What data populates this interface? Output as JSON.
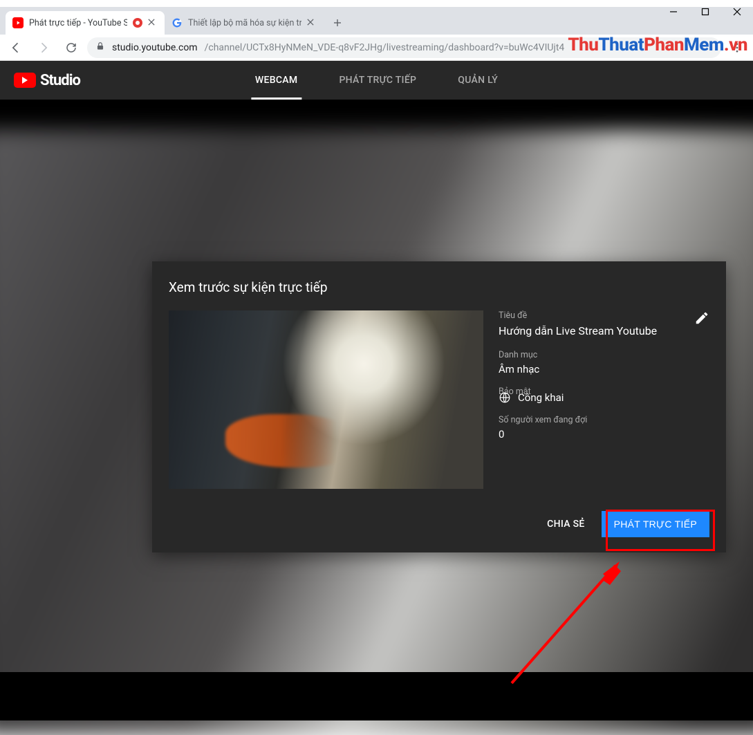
{
  "window": {
    "tabs": [
      {
        "title": "Phát trực tiếp - YouTube Stu",
        "active": true,
        "favicon": "youtube"
      },
      {
        "title": "Thiết lập bộ mã hóa sự kiện trực",
        "active": false,
        "favicon": "google"
      }
    ],
    "url_host": "studio.youtube.com",
    "url_path": "/channel/UCTx8HyNMeN_VDE-q8vF2JHg/livestreaming/dashboard?v=buWc4VIUjt4"
  },
  "watermark": {
    "parts": [
      "Thu",
      "Thuat",
      "Phan",
      "Mem",
      ".vn"
    ]
  },
  "studio": {
    "brand": "Studio",
    "nav": {
      "webcam": "WEBCAM",
      "live": "PHÁT TRỰC TIẾP",
      "manage": "QUẢN LÝ",
      "active": "webcam"
    }
  },
  "modal": {
    "title": "Xem trước sự kiện trực tiếp",
    "fields": {
      "title_label": "Tiêu đề",
      "title_value": "Hướng dẫn Live Stream Youtube",
      "category_label": "Danh mục",
      "category_value": "Âm nhạc",
      "privacy_label": "Bảo mật",
      "privacy_value": "Công khai",
      "waiting_label": "Số người xem đang đợi",
      "waiting_value": "0"
    },
    "actions": {
      "share": "CHIA SẺ",
      "go_live": "PHÁT TRỰC TIẾP"
    }
  },
  "annotation": {
    "highlight_target": "go-live-button"
  }
}
